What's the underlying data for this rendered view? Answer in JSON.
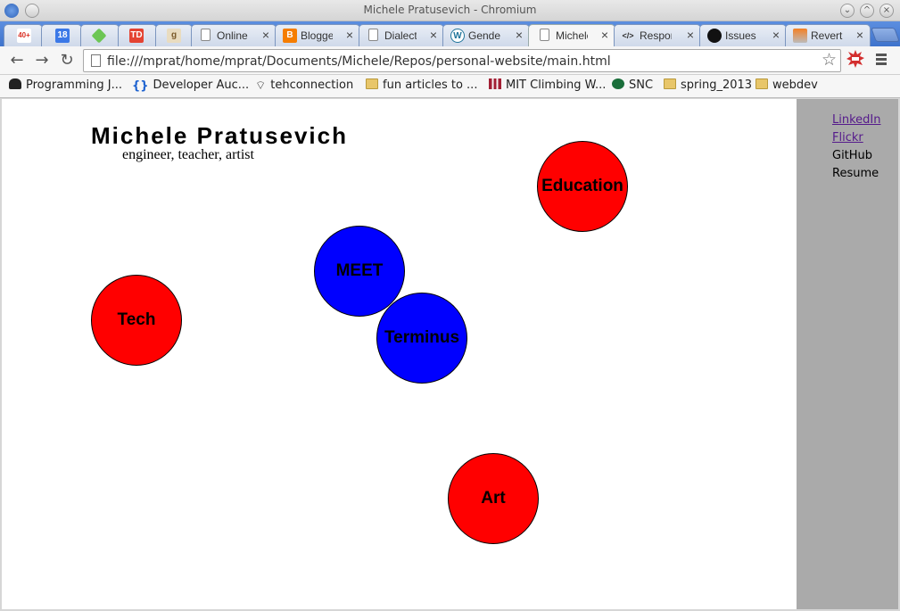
{
  "window": {
    "title": "Michele Pratusevich - Chromium",
    "minimize_glyph": "⌄",
    "maximize_glyph": "^",
    "close_glyph": "×"
  },
  "tabs": [
    {
      "label": "",
      "icon": "gmail-icon",
      "badge": "40+",
      "color": "#d93025"
    },
    {
      "label": "",
      "icon": "calendar-icon",
      "badge": "18",
      "color": "#3b78e7"
    },
    {
      "label": "",
      "icon": "feedly-icon",
      "badge": "",
      "color": "#6cc655"
    },
    {
      "label": "",
      "icon": "todoist-icon",
      "badge": "TD",
      "color": "#e44332"
    },
    {
      "label": "",
      "icon": "goodreads-icon",
      "badge": "g",
      "color": "#c9b07a"
    },
    {
      "label": "Online",
      "icon": "page-icon",
      "badge": "",
      "color": "#ffffff"
    },
    {
      "label": "Blogger",
      "icon": "blogger-icon",
      "badge": "",
      "color": "#f57d00"
    },
    {
      "label": "Dialect",
      "icon": "page-icon",
      "badge": "",
      "color": "#ffffff"
    },
    {
      "label": "Gender",
      "icon": "wordpress-icon",
      "badge": "",
      "color": "#21759b"
    },
    {
      "label": "Michele",
      "icon": "page-icon",
      "badge": "",
      "color": "#ffffff",
      "active": true
    },
    {
      "label": "Respon",
      "icon": "code-icon",
      "badge": "",
      "color": "#ffffff"
    },
    {
      "label": "Issues",
      "icon": "github-icon",
      "badge": "",
      "color": "#000000"
    },
    {
      "label": "Revert",
      "icon": "stackoverflow-icon",
      "badge": "",
      "color": "#f48024"
    }
  ],
  "toolbar": {
    "back": "←",
    "forward": "→",
    "reload": "↻",
    "url": "file:///mprat/home/mprat/Documents/Michele/Repos/personal-website/main.html",
    "star": "☆"
  },
  "bookmarks": [
    {
      "label": "Programming J...",
      "icon": "spy-icon"
    },
    {
      "label": "Developer Auc...",
      "icon": "braces-icon"
    },
    {
      "label": "tehconnection",
      "icon": "wifi-icon"
    },
    {
      "label": "fun articles to ...",
      "icon": "folder-icon"
    },
    {
      "label": "MIT Climbing W...",
      "icon": "mit-icon"
    },
    {
      "label": "SNC",
      "icon": "snc-icon"
    },
    {
      "label": "spring_2013",
      "icon": "folder-icon"
    },
    {
      "label": "webdev",
      "icon": "folder-icon"
    }
  ],
  "site": {
    "title": "Michele Pratusevich",
    "subtitle": "engineer, teacher, artist",
    "bubbles": [
      {
        "label": "Education",
        "color": "red"
      },
      {
        "label": "MEET",
        "color": "blue"
      },
      {
        "label": "Tech",
        "color": "red"
      },
      {
        "label": "Terminus",
        "color": "blue"
      },
      {
        "label": "Art",
        "color": "red"
      }
    ],
    "sidebar_links": [
      {
        "label": "LinkedIn",
        "visited": true
      },
      {
        "label": "Flickr",
        "visited": true
      },
      {
        "label": "GitHub",
        "visited": false
      },
      {
        "label": "Resume",
        "visited": false
      }
    ]
  }
}
